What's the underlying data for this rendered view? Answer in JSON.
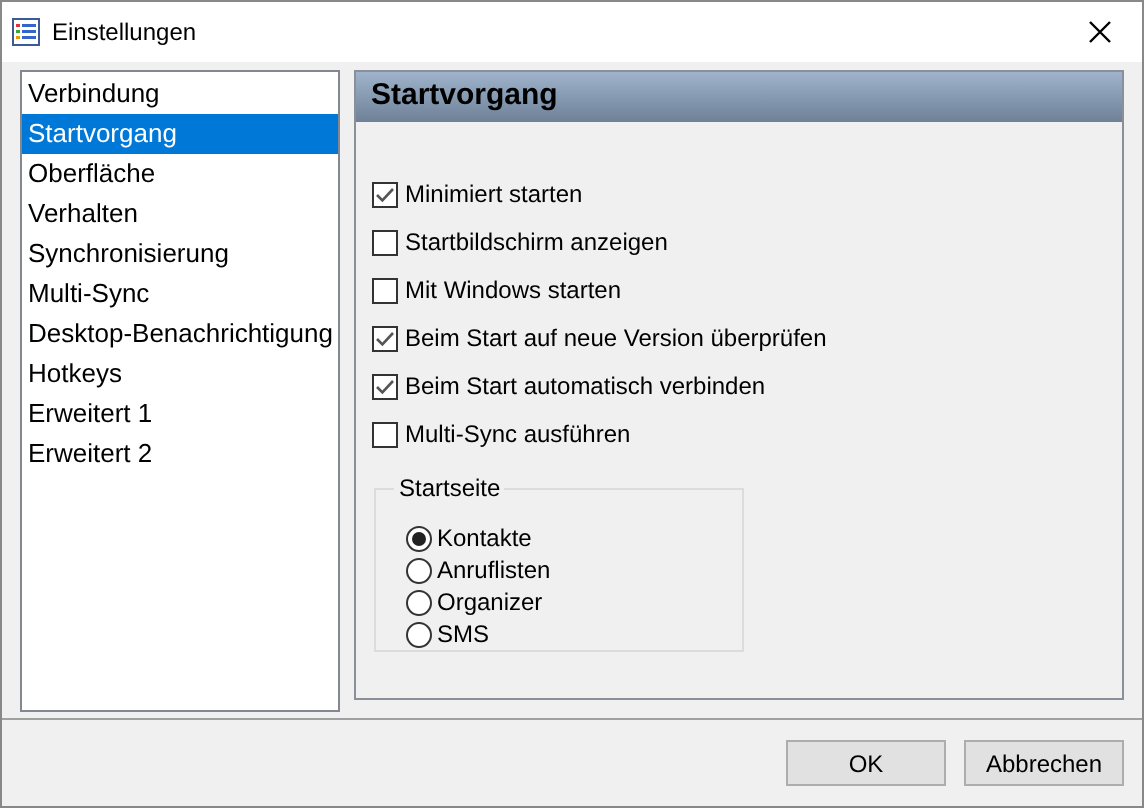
{
  "window": {
    "title": "Einstellungen"
  },
  "sidebar": {
    "items": [
      {
        "label": "Verbindung",
        "selected": false
      },
      {
        "label": "Startvorgang",
        "selected": true
      },
      {
        "label": "Oberfläche",
        "selected": false
      },
      {
        "label": "Verhalten",
        "selected": false
      },
      {
        "label": "Synchronisierung",
        "selected": false
      },
      {
        "label": "Multi-Sync",
        "selected": false
      },
      {
        "label": "Desktop-Benachrichtigung",
        "selected": false
      },
      {
        "label": "Hotkeys",
        "selected": false
      },
      {
        "label": "Erweitert 1",
        "selected": false
      },
      {
        "label": "Erweitert 2",
        "selected": false
      }
    ]
  },
  "panel": {
    "title": "Startvorgang",
    "options": [
      {
        "label": "Minimiert starten",
        "checked": true
      },
      {
        "label": "Startbildschirm anzeigen",
        "checked": false
      },
      {
        "label": "Mit Windows starten",
        "checked": false
      },
      {
        "label": "Beim Start auf neue Version überprüfen",
        "checked": true
      },
      {
        "label": "Beim Start automatisch verbinden",
        "checked": true
      },
      {
        "label": "Multi-Sync ausführen",
        "checked": false
      }
    ],
    "start_page": {
      "title": "Startseite",
      "choices": [
        {
          "label": "Kontakte",
          "selected": true
        },
        {
          "label": "Anruflisten",
          "selected": false
        },
        {
          "label": "Organizer",
          "selected": false
        },
        {
          "label": "SMS",
          "selected": false
        }
      ]
    }
  },
  "buttons": [
    "OK",
    "Abbrechen"
  ]
}
